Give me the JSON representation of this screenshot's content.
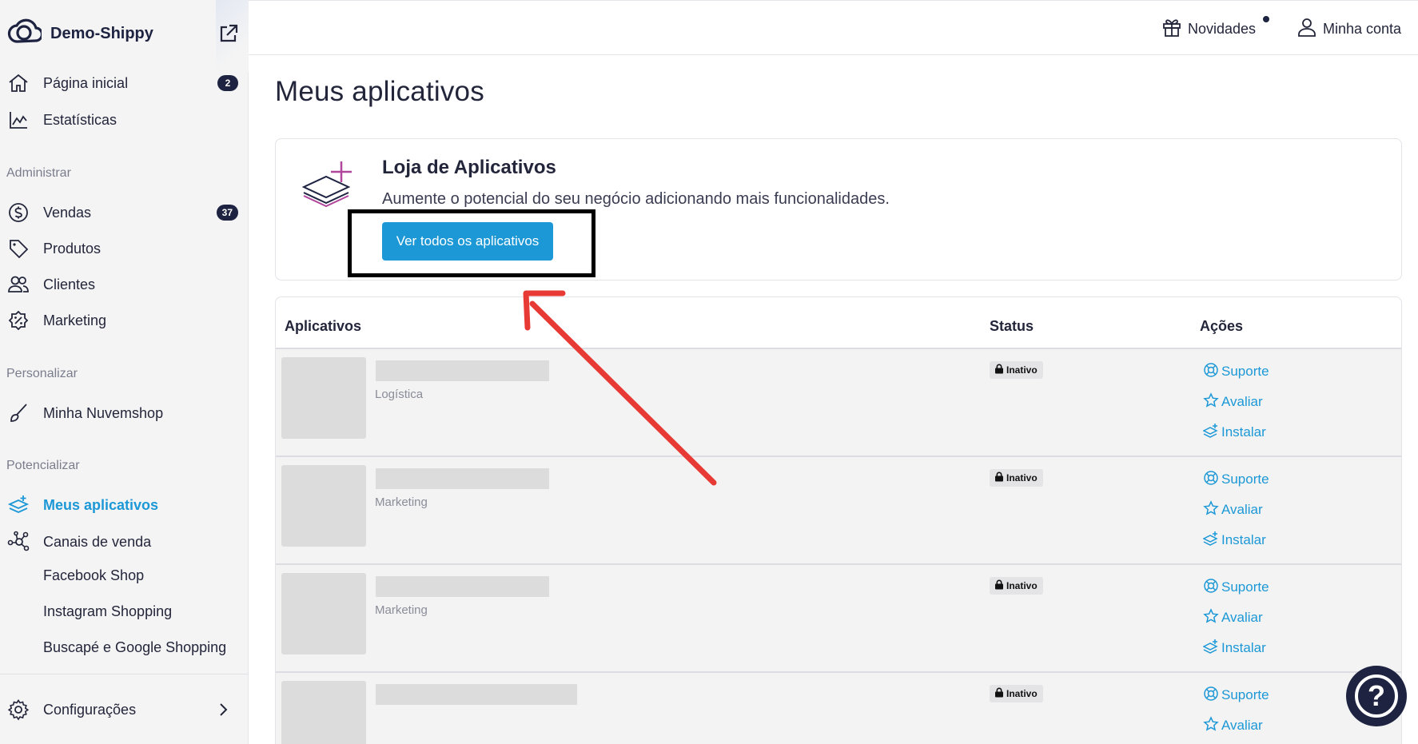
{
  "brand": {
    "name": "Demo-Shippy",
    "icon": "cloud-logo-icon",
    "external_icon": "external-link-icon"
  },
  "topbar": {
    "novidades": {
      "label": "Novidades",
      "icon": "gift-icon",
      "has_dot": true
    },
    "account": {
      "label": "Minha conta",
      "icon": "user-icon"
    }
  },
  "sidebar": {
    "primary": [
      {
        "label": "Página inicial",
        "icon": "home-icon",
        "badge": "2"
      },
      {
        "label": "Estatísticas",
        "icon": "chart-icon"
      }
    ],
    "sections": {
      "administrar": "Administrar",
      "personalizar": "Personalizar",
      "potencializar": "Potencializar"
    },
    "administrar": [
      {
        "label": "Vendas",
        "icon": "dollar-icon",
        "badge": "37"
      },
      {
        "label": "Produtos",
        "icon": "tag-icon"
      },
      {
        "label": "Clientes",
        "icon": "users-icon"
      },
      {
        "label": "Marketing",
        "icon": "discount-icon"
      }
    ],
    "personalizar": [
      {
        "label": "Minha Nuvemshop",
        "icon": "brush-icon"
      }
    ],
    "potencializar": [
      {
        "label": "Meus aplicativos",
        "icon": "apps-icon",
        "active": true
      },
      {
        "label": "Canais de venda",
        "icon": "network-icon"
      }
    ],
    "canais_sub": [
      "Facebook Shop",
      "Instagram Shopping",
      "Buscapé e Google Shopping"
    ],
    "settings": {
      "label": "Configurações",
      "icon": "gear-icon"
    }
  },
  "main": {
    "title": "Meus aplicativos",
    "store": {
      "title": "Loja de Aplicativos",
      "description": "Aumente o potencial do seu negócio adicionando mais funcionalidades.",
      "button": "Ver todos os aplicativos"
    },
    "table": {
      "headers": {
        "apps": "Aplicativos",
        "status": "Status",
        "actions": "Ações"
      },
      "rows": [
        {
          "category": "Logística",
          "status": "Inativo"
        },
        {
          "category": "Marketing",
          "status": "Inativo"
        },
        {
          "category": "Marketing",
          "status": "Inativo"
        },
        {
          "category": "",
          "status": "Inativo"
        }
      ],
      "actions": {
        "support": "Suporte",
        "rate": "Avaliar",
        "install": "Instalar"
      }
    }
  },
  "help": {
    "label": "?"
  },
  "colors": {
    "accent": "#1c98d6",
    "navy": "#1d2340",
    "annotation_red": "#e83a35"
  }
}
